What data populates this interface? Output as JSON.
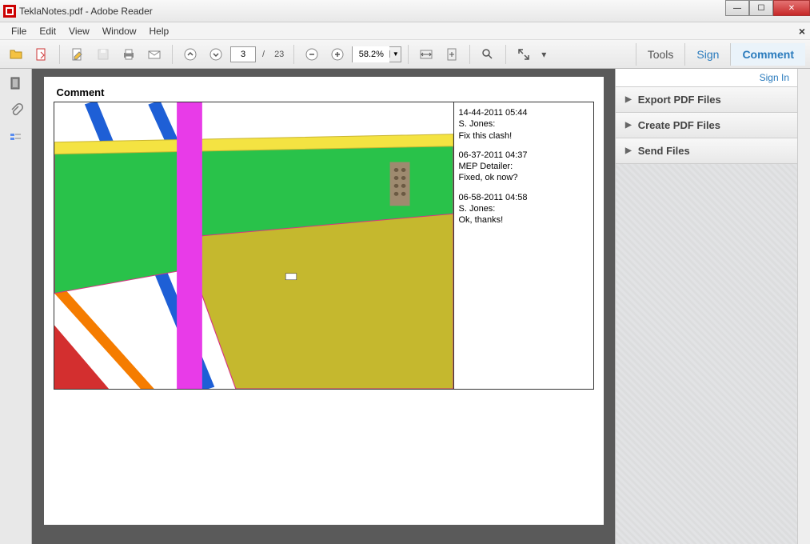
{
  "window": {
    "title": "TeklaNotes.pdf - Adobe Reader"
  },
  "menu": {
    "file": "File",
    "edit": "Edit",
    "view": "View",
    "window": "Window",
    "help": "Help"
  },
  "toolbar": {
    "page_current": "3",
    "page_sep": "/",
    "page_total": "23",
    "zoom": "58.2%",
    "tools": "Tools",
    "sign": "Sign",
    "comment": "Comment"
  },
  "right_panel": {
    "sign_in": "Sign In",
    "items": [
      "Export PDF Files",
      "Create PDF Files",
      "Send Files"
    ]
  },
  "document": {
    "heading": "Comment",
    "comments": [
      {
        "ts": "14-44-2011 05:44",
        "author": "S. Jones:",
        "text": "Fix this clash!"
      },
      {
        "ts": "06-37-2011 04:37",
        "author": "MEP Detailer:",
        "text": "Fixed, ok now?"
      },
      {
        "ts": "06-58-2011 04:58",
        "author": "S. Jones:",
        "text": "Ok, thanks!"
      }
    ]
  }
}
